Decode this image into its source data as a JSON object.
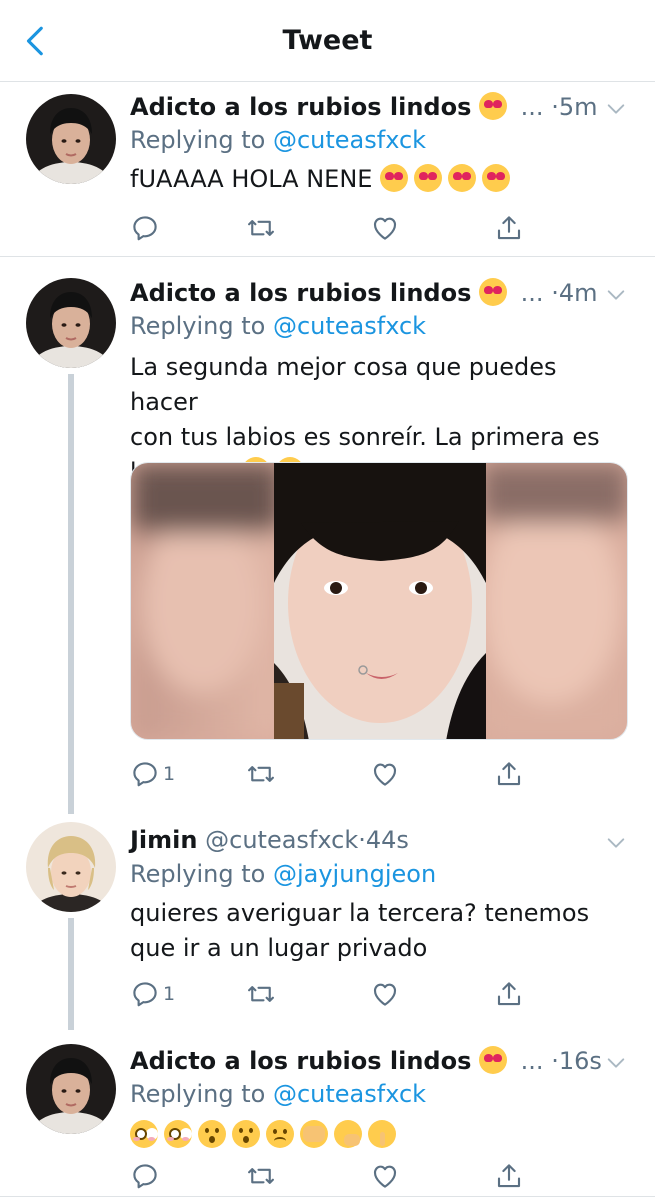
{
  "header": {
    "title": "Tweet"
  },
  "tweets": [
    {
      "name": "Adicto a los rubios lindos",
      "handle": "",
      "dots": "...",
      "time": "·5m",
      "replying_prefix": "Replying to",
      "replying_to": "@cuteasfxck",
      "text": "fUAAAA HOLA NENE",
      "reply_count": ""
    },
    {
      "name": "Adicto a los rubios lindos",
      "handle": "",
      "dots": "...",
      "time": "·4m",
      "replying_prefix": "Replying to",
      "replying_to": "@cuteasfxck",
      "text_line1": "La segunda mejor cosa que puedes hacer",
      "text_line2": "con tus labios es sonreír. La primera es",
      "text_line3": "besarme",
      "reply_count": "1"
    },
    {
      "name": "Jimin",
      "handle": "@cuteasfxck",
      "time": "·44s",
      "replying_prefix": "Replying to",
      "replying_to": "@jayjungjeon",
      "text_line1": "quieres averiguar la tercera? tenemos",
      "text_line2": "que ir a un lugar privado",
      "reply_count": "1"
    },
    {
      "name": "Adicto a los rubios lindos",
      "handle": "",
      "dots": "...",
      "time": "·16s",
      "replying_prefix": "Replying to",
      "replying_to": "@cuteasfxck",
      "reply_count": ""
    }
  ],
  "colors": {
    "link": "#1b95e0",
    "secondary": "#5b7083",
    "thread_line": "#c9d1d8",
    "heart_emoji": "#e0245e"
  },
  "icons": [
    "back-icon",
    "chevron-down-icon",
    "reply-icon",
    "retweet-icon",
    "like-icon",
    "share-icon"
  ]
}
